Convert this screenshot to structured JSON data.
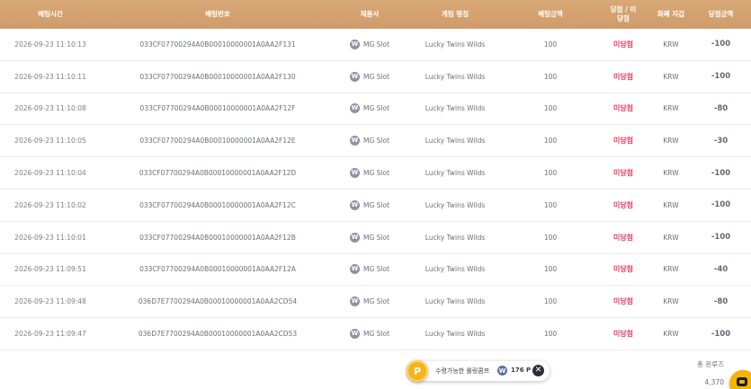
{
  "columns": {
    "time": "베팅시간",
    "id": "베팅번호",
    "provider": "제품사",
    "game": "게임 명칭",
    "bet": "베팅금액",
    "result": "당첨 / 미당첨",
    "currency": "화폐 지갑",
    "win": "당첨금액"
  },
  "rows": [
    {
      "time": "2026-09-23 11:10:13",
      "id": "033CF07700294A0B00010000001A0AA2F131",
      "provider": "MG Slot",
      "game": "Lucky Twins Wilds",
      "bet": "100",
      "result": "미당첨",
      "currency": "KRW",
      "win": "-100"
    },
    {
      "time": "2026-09-23 11:10:11",
      "id": "033CF07700294A0B00010000001A0AA2F130",
      "provider": "MG Slot",
      "game": "Lucky Twins Wilds",
      "bet": "100",
      "result": "미당첨",
      "currency": "KRW",
      "win": "-100"
    },
    {
      "time": "2026-09-23 11:10:08",
      "id": "033CF07700294A0B00010000001A0AA2F12F",
      "provider": "MG Slot",
      "game": "Lucky Twins Wilds",
      "bet": "100",
      "result": "미당첨",
      "currency": "KRW",
      "win": "-80"
    },
    {
      "time": "2026-09-23 11:10:05",
      "id": "033CF07700294A0B00010000001A0AA2F12E",
      "provider": "MG Slot",
      "game": "Lucky Twins Wilds",
      "bet": "100",
      "result": "미당첨",
      "currency": "KRW",
      "win": "-30"
    },
    {
      "time": "2026-09-23 11:10:04",
      "id": "033CF07700294A0B00010000001A0AA2F12D",
      "provider": "MG Slot",
      "game": "Lucky Twins Wilds",
      "bet": "100",
      "result": "미당첨",
      "currency": "KRW",
      "win": "-100"
    },
    {
      "time": "2026-09-23 11:10:02",
      "id": "033CF07700294A0B00010000001A0AA2F12C",
      "provider": "MG Slot",
      "game": "Lucky Twins Wilds",
      "bet": "100",
      "result": "미당첨",
      "currency": "KRW",
      "win": "-100"
    },
    {
      "time": "2026-09-23 11:10:01",
      "id": "033CF07700294A0B00010000001A0AA2F12B",
      "provider": "MG Slot",
      "game": "Lucky Twins Wilds",
      "bet": "100",
      "result": "미당첨",
      "currency": "KRW",
      "win": "-100"
    },
    {
      "time": "2026-09-23 11:09:51",
      "id": "033CF07700294A0B00010000001A0AA2F12A",
      "provider": "MG Slot",
      "game": "Lucky Twins Wilds",
      "bet": "100",
      "result": "미당첨",
      "currency": "KRW",
      "win": "-40"
    },
    {
      "time": "2026-09-23 11:09:48",
      "id": "036D7E7700294A0B00010000001A0AA2CD54",
      "provider": "MG Slot",
      "game": "Lucky Twins Wilds",
      "bet": "100",
      "result": "미당첨",
      "currency": "KRW",
      "win": "-80"
    },
    {
      "time": "2026-09-23 11:09:47",
      "id": "036D7E7700294A0B00010000001A0AA2CD53",
      "provider": "MG Slot",
      "game": "Lucky Twins Wilds",
      "bet": "100",
      "result": "미당첨",
      "currency": "KRW",
      "win": "-100"
    }
  ],
  "provider_logo_letter": "W",
  "total": {
    "label": "총 윈루즈",
    "value": "4,370"
  },
  "coupon": {
    "badge": "P",
    "text": "수령가능한 롤링콤프",
    "coin_letter": "W",
    "amount": "176 P",
    "close_glyph": "✕"
  },
  "colors": {
    "header": "#d9a877",
    "lose_text": "#ef3b63",
    "coupon_badge": "#f2b51e",
    "chat_button": "#f4b400"
  },
  "icons": {
    "provider": "mg-slot-logo-icon",
    "coupon": "point-badge-icon",
    "coin": "coin-icon",
    "close": "close-icon",
    "chat": "chat-icon"
  }
}
